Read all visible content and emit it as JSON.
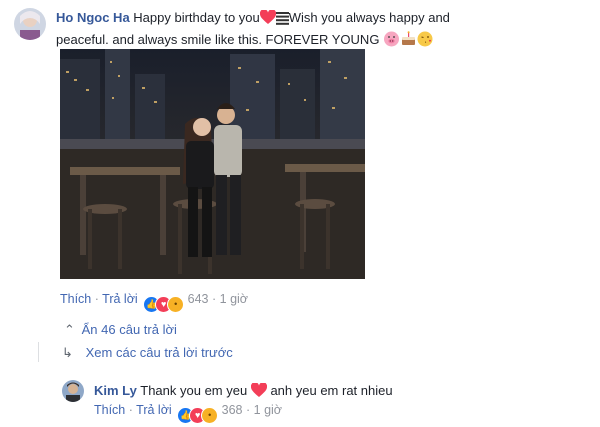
{
  "comment": {
    "author": "Ho Ngoc Ha",
    "text_part1": "Happy birthday to you",
    "text_part2": "Wish you always happy and",
    "text_line2": "peaceful. and always smile like this. FOREVER YOUNG",
    "actions": {
      "like": "Thích",
      "reply": "Trả lời",
      "reaction_count": "643",
      "time": "1 giờ",
      "sep": "·"
    }
  },
  "replies_toggle": {
    "hide_label": "Ẩn 46 câu trả lời",
    "prev_label": "Xem các câu trả lời trước"
  },
  "reply": {
    "author": "Kim Ly",
    "text_part1": "Thank you em yeu",
    "text_part2": "anh yeu em rat nhieu",
    "actions": {
      "like": "Thích",
      "reply": "Trả lời",
      "reaction_count": "368",
      "time": "1 giờ",
      "sep": "·"
    }
  },
  "icons": [
    "heart-icon",
    "pig-icon",
    "cake-icon",
    "kiss-icon",
    "like-reaction-icon",
    "love-reaction-icon",
    "wow-reaction-icon",
    "chevron-up-icon",
    "reply-arrow-icon"
  ],
  "colors": {
    "name": "#365899",
    "link": "#4267b2",
    "meta": "#90949c",
    "heart": "#f33e58"
  }
}
